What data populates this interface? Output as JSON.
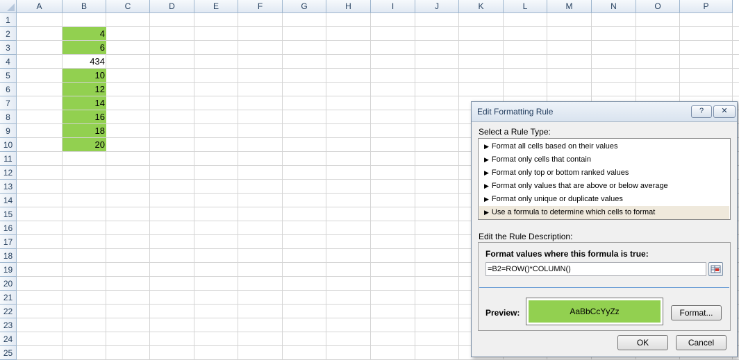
{
  "sheet": {
    "columns": [
      "A",
      "B",
      "C",
      "D",
      "E",
      "F",
      "G",
      "H",
      "I",
      "J",
      "K",
      "L",
      "M",
      "N",
      "O",
      "P"
    ],
    "rows": [
      "1",
      "2",
      "3",
      "4",
      "5",
      "6",
      "7",
      "8",
      "9",
      "10",
      "11",
      "12",
      "13",
      "14",
      "15",
      "16",
      "17",
      "18",
      "19",
      "20",
      "21",
      "22",
      "23",
      "24",
      "25"
    ],
    "cells_B": [
      {
        "row": "2",
        "value": "4",
        "highlighted": true
      },
      {
        "row": "3",
        "value": "6",
        "highlighted": true
      },
      {
        "row": "4",
        "value": "434",
        "highlighted": false
      },
      {
        "row": "5",
        "value": "10",
        "highlighted": true
      },
      {
        "row": "6",
        "value": "12",
        "highlighted": true
      },
      {
        "row": "7",
        "value": "14",
        "highlighted": true
      },
      {
        "row": "8",
        "value": "16",
        "highlighted": true
      },
      {
        "row": "9",
        "value": "18",
        "highlighted": true
      },
      {
        "row": "10",
        "value": "20",
        "highlighted": true
      }
    ],
    "highlight_color": "#92d050"
  },
  "dialog": {
    "title": "Edit Formatting Rule",
    "help_label": "?",
    "close_label": "✕",
    "select_rule_label": "Select a Rule Type:",
    "rule_types": [
      "Format all cells based on their values",
      "Format only cells that contain",
      "Format only top or bottom ranked values",
      "Format only values that are above or below average",
      "Format only unique or duplicate values",
      "Use a formula to determine which cells to format"
    ],
    "selected_rule_index": 5,
    "edit_desc_label": "Edit the Rule Description:",
    "formula_label": "Format values where this formula is true:",
    "formula_value": "=B2=ROW()*COLUMN()",
    "preview_label": "Preview:",
    "preview_text": "AaBbCcYyZz",
    "format_button": "Format...",
    "ok_button": "OK",
    "cancel_button": "Cancel"
  }
}
